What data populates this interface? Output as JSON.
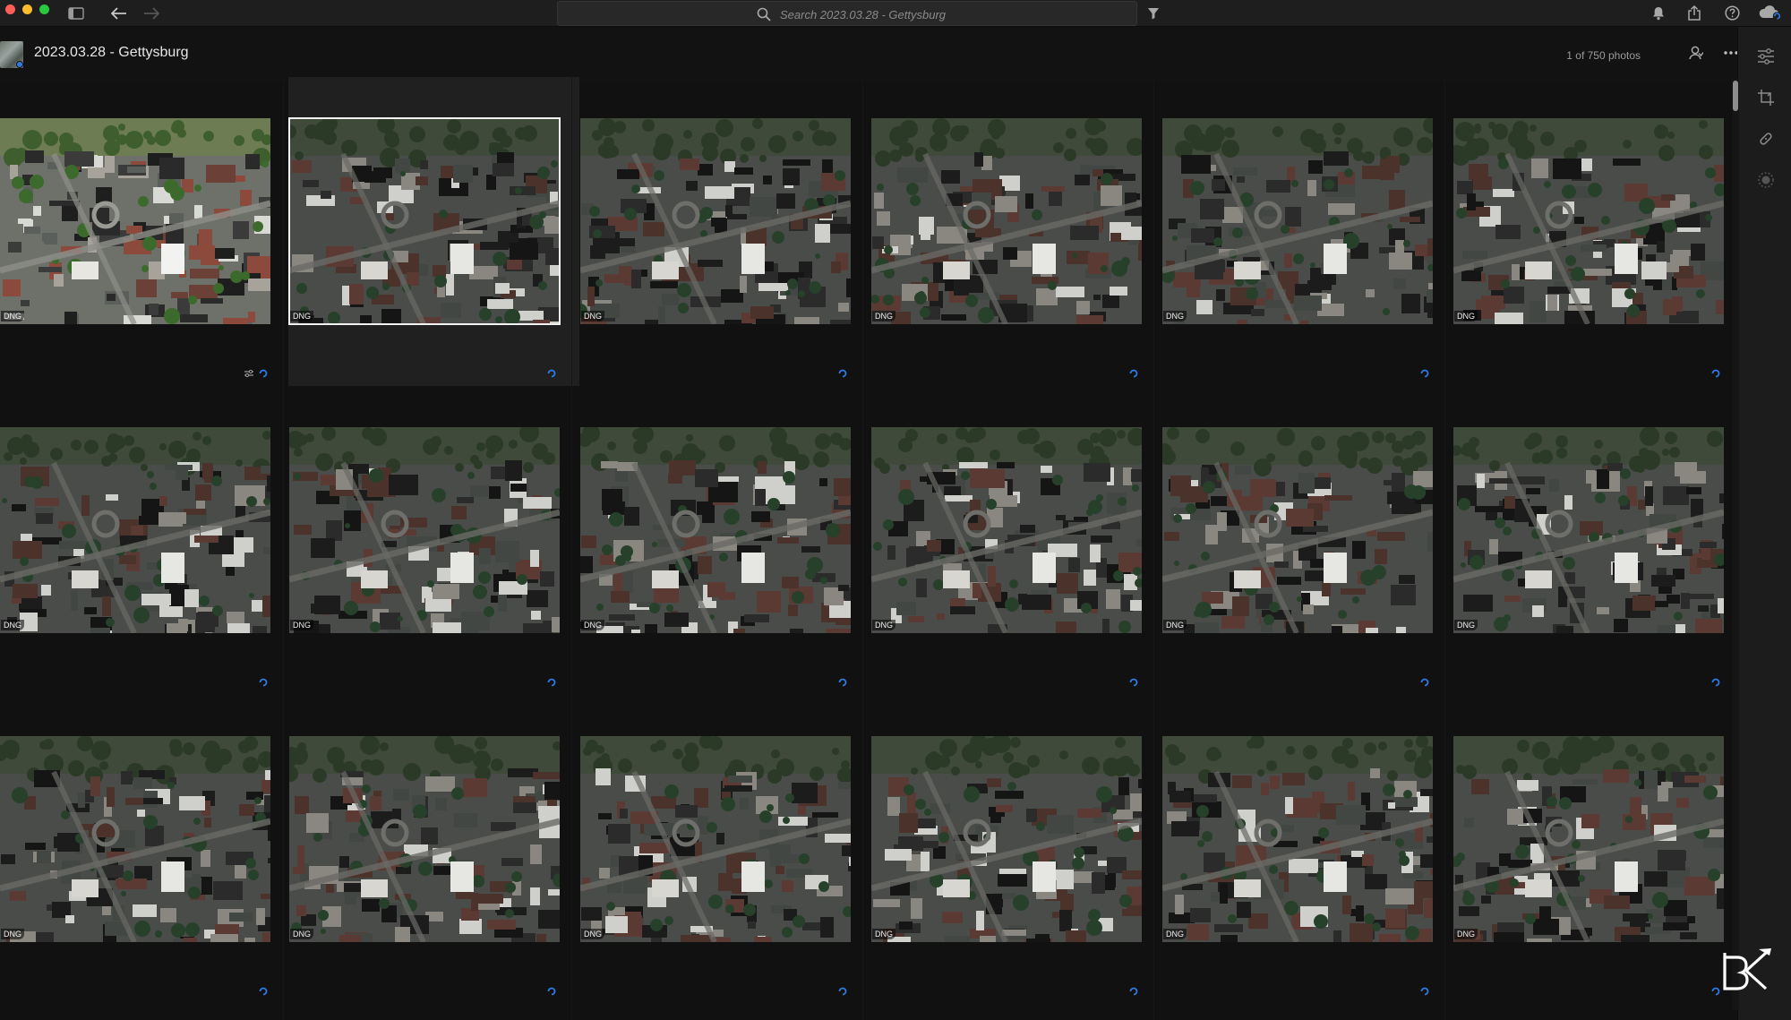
{
  "toolbar": {
    "search_placeholder": "Search 2023.03.28 - Gettysburg",
    "icons": [
      "sidebar-toggle-icon",
      "back-arrow-icon",
      "forward-arrow-icon",
      "search-icon",
      "filter-icon",
      "bell-icon",
      "share-icon",
      "help-icon",
      "cloud-sync-icon"
    ]
  },
  "album": {
    "title": "2023.03.28 - Gettysburg",
    "photo_count": "1 of 750 photos"
  },
  "right_panel": {
    "icons": [
      "edit-sliders-icon",
      "crop-icon",
      "healing-brush-icon",
      "masking-icon"
    ]
  },
  "grid": {
    "columns": 6,
    "rows": 3,
    "selected_index": 1,
    "photos": [
      {
        "format": "DNG",
        "edited": true,
        "selected": false
      },
      {
        "format": "DNG",
        "edited": false,
        "selected": true
      },
      {
        "format": "DNG",
        "edited": false,
        "selected": false
      },
      {
        "format": "DNG",
        "edited": false,
        "selected": false
      },
      {
        "format": "DNG",
        "edited": false,
        "selected": false
      },
      {
        "format": "DNG",
        "edited": false,
        "selected": false
      },
      {
        "format": "DNG",
        "edited": false,
        "selected": false
      },
      {
        "format": "DNG",
        "edited": false,
        "selected": false
      },
      {
        "format": "DNG",
        "edited": false,
        "selected": false
      },
      {
        "format": "DNG",
        "edited": false,
        "selected": false
      },
      {
        "format": "DNG",
        "edited": false,
        "selected": false
      },
      {
        "format": "DNG",
        "edited": false,
        "selected": false
      },
      {
        "format": "DNG",
        "edited": false,
        "selected": false
      },
      {
        "format": "DNG",
        "edited": false,
        "selected": false
      },
      {
        "format": "DNG",
        "edited": false,
        "selected": false
      },
      {
        "format": "DNG",
        "edited": false,
        "selected": false
      },
      {
        "format": "DNG",
        "edited": false,
        "selected": false
      },
      {
        "format": "DNG",
        "edited": false,
        "selected": false
      }
    ]
  },
  "colors": {
    "sync_accent": "#2f7be6",
    "background": "#111111",
    "toolbar": "#1e1e1e"
  },
  "watermark": "BK"
}
